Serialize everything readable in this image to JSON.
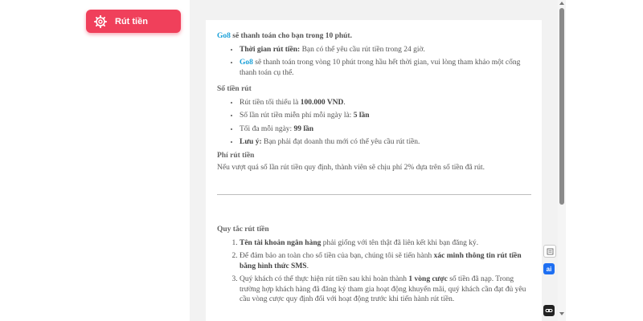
{
  "menu": {
    "withdraw_label": "Rút tiền"
  },
  "intro": {
    "brand": "Go8",
    "text": " sẽ thanh toán cho bạn trong 10 phút.",
    "bullets": [
      {
        "bold": "Thời gian rút tiền:",
        "text": " Bạn có thể yêu cầu rút tiền trong 24 giờ."
      },
      {
        "brand": "Go8",
        "text": " sẽ thanh toán trong vòng 10 phút trong hầu hết thời gian, vui lòng tham khảo một cổng thanh toán cụ thể."
      }
    ]
  },
  "amount": {
    "title": "Số tiền rút",
    "items": [
      {
        "pre": "Rút tiền tối thiểu là ",
        "bold": "100.000 VND",
        "post": "."
      },
      {
        "pre": "Số lần rút tiền miễn phí mỗi ngày là: ",
        "bold": "5 lần",
        "post": ""
      },
      {
        "pre": "Tối đa mỗi ngày: ",
        "bold": "99 lần",
        "post": ""
      },
      {
        "pre": "",
        "bold": "Lưu ý:",
        "post": " Bạn phải đạt doanh thu mới có thể yêu cầu rút tiền."
      }
    ]
  },
  "fee": {
    "title": "Phí rút tiền",
    "text": "Nếu vượt quá số lần rút tiền quy định, thành viên sẽ chịu phí 2% dựa trên số tiền đã rút."
  },
  "rules": {
    "title": "Quy tắc rút tiền",
    "items": [
      {
        "bold1": "Tên tài khoản ngân hàng",
        "text1": " phải giống với tên thật đã liên kết khi bạn đăng ký.",
        "bold2": "",
        "text2": ""
      },
      {
        "bold1": "",
        "text1": "Để đảm bảo an toàn cho số tiền của bạn, chúng tôi sẽ tiến hành ",
        "bold2": "xác minh thông tin rút tiền bằng hình thức SMS",
        "text2": "."
      },
      {
        "bold1": "",
        "text1": "Quý khách có thể thực hiện rút tiền sau khi hoàn thành ",
        "bold2": "1 vòng cược",
        "text2": " số tiền đã nạp. Trong trường hợp khách hàng đã đăng ký tham gia hoạt động khuyến mãi, quý khách cần đạt đủ yêu cầu vòng cược quy định đối với hoạt động trước khi tiến hành rút tiền."
      }
    ]
  },
  "widgets": {
    "ai_label": "ai"
  },
  "colors": {
    "accent": "#f0405b",
    "brand": "#1aa0d8"
  }
}
